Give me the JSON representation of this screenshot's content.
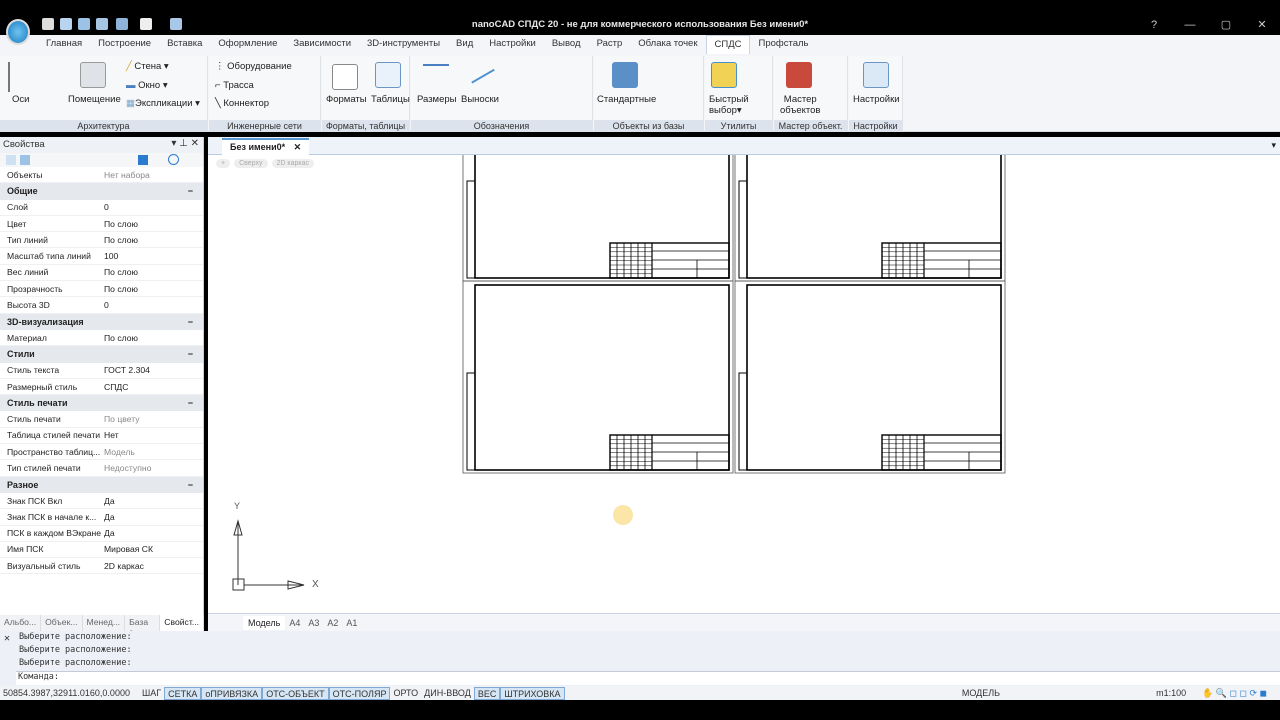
{
  "title": "nanoCAD СПДС 20 - не для коммерческого использования Без имени0*",
  "menu_tabs": [
    "Главная",
    "Построение",
    "Вставка",
    "Оформление",
    "Зависимости",
    "3D-инструменты",
    "Вид",
    "Настройки",
    "Вывод",
    "Растр",
    "Облака точек",
    "СПДС",
    "Профсталь"
  ],
  "active_tab": "СПДС",
  "ribbon": {
    "groups": [
      "Архитектура",
      "Инженерные сети",
      "Форматы, таблицы",
      "Обозначения",
      "Объекты из базы",
      "Утилиты",
      "Мастер объект.",
      "Настройки"
    ],
    "arch": {
      "axes": "Оси",
      "room": "Помещение",
      "wall": "Стена",
      "window": "Окно",
      "expl": "Экспликации"
    },
    "eng": {
      "equipment": "Оборудование",
      "route": "Трасса",
      "connector": "Коннектор"
    },
    "formats": {
      "formats": "Форматы",
      "tables": "Таблицы"
    },
    "annot": {
      "dims": "Размеры",
      "leaders": "Выноски"
    },
    "base": {
      "standard": "Стандартные"
    },
    "utils": {
      "quick1": "Быстрый",
      "quick2": "выбор"
    },
    "master": {
      "l1": "Мастер",
      "l2": "объектов"
    },
    "settings": {
      "label": "Настройки"
    }
  },
  "properties": {
    "title": "Свойства",
    "objects_label": "Объекты",
    "objects_value": "Нет набора",
    "sections": [
      {
        "name": "Общие",
        "rows": [
          [
            "Слой",
            "0"
          ],
          [
            "Цвет",
            "По слою"
          ],
          [
            "Тип линий",
            "По слою"
          ],
          [
            "Масштаб типа линий",
            "100"
          ],
          [
            "Вес линий",
            "По слою"
          ],
          [
            "Прозрачность",
            "По слою"
          ],
          [
            "Высота 3D",
            "0"
          ]
        ]
      },
      {
        "name": "3D-визуализация",
        "rows": [
          [
            "Материал",
            "По слою"
          ]
        ]
      },
      {
        "name": "Стили",
        "rows": [
          [
            "Стиль текста",
            "ГОСТ 2.304"
          ],
          [
            "Размерный стиль",
            "СПДС"
          ]
        ]
      },
      {
        "name": "Стиль печати",
        "rows": [
          [
            "Стиль печати",
            "По цвету"
          ],
          [
            "Таблица стилей печати",
            "Нет"
          ],
          [
            "Пространство таблиц...",
            "Модель"
          ],
          [
            "Тип стилей печати",
            "Недоступно"
          ]
        ]
      },
      {
        "name": "Разное",
        "rows": [
          [
            "Знак ПСК Вкл",
            "Да"
          ],
          [
            "Знак ПСК в начале к...",
            "Да"
          ],
          [
            "ПСК в каждом ВЭкране",
            "Да"
          ],
          [
            "Имя ПСК",
            "Мировая СК"
          ],
          [
            "Визуальный стиль",
            "2D каркас"
          ]
        ]
      }
    ],
    "bottom_tabs": [
      "Альбо...",
      "Объек...",
      "Менед...",
      "База э...",
      "Свойст..."
    ]
  },
  "document": {
    "tab": "Без имени0*",
    "view_controls": [
      "+",
      "Сверху",
      "2D каркас"
    ]
  },
  "ucs": {
    "x": "X",
    "y": "Y"
  },
  "layout_tabs": [
    "Модель",
    "A4",
    "A3",
    "A2",
    "A1"
  ],
  "command": {
    "history": [
      "Выберите расположение:",
      "Выберите расположение:",
      "Выберите расположение:"
    ],
    "prompt": "Команда:"
  },
  "status": {
    "coords": "50854.3987,32911.0160,0.0000",
    "toggles": [
      [
        "ШАГ",
        false
      ],
      [
        "СЕТКА",
        true
      ],
      [
        "оПРИВЯЗКА",
        true
      ],
      [
        "ОТС-ОБЪЕКТ",
        true
      ],
      [
        "ОТС-ПОЛЯР",
        true
      ],
      [
        "ОРТО",
        false
      ],
      [
        "ДИН-ВВОД",
        false
      ],
      [
        "ВЕС",
        true
      ],
      [
        "ШТРИХОВКА",
        true
      ]
    ],
    "space": "МОДЕЛЬ",
    "scale": "m1:100"
  },
  "colors": {
    "accent": "#5b9bd5",
    "toggle_on": "#d6e6f5"
  }
}
